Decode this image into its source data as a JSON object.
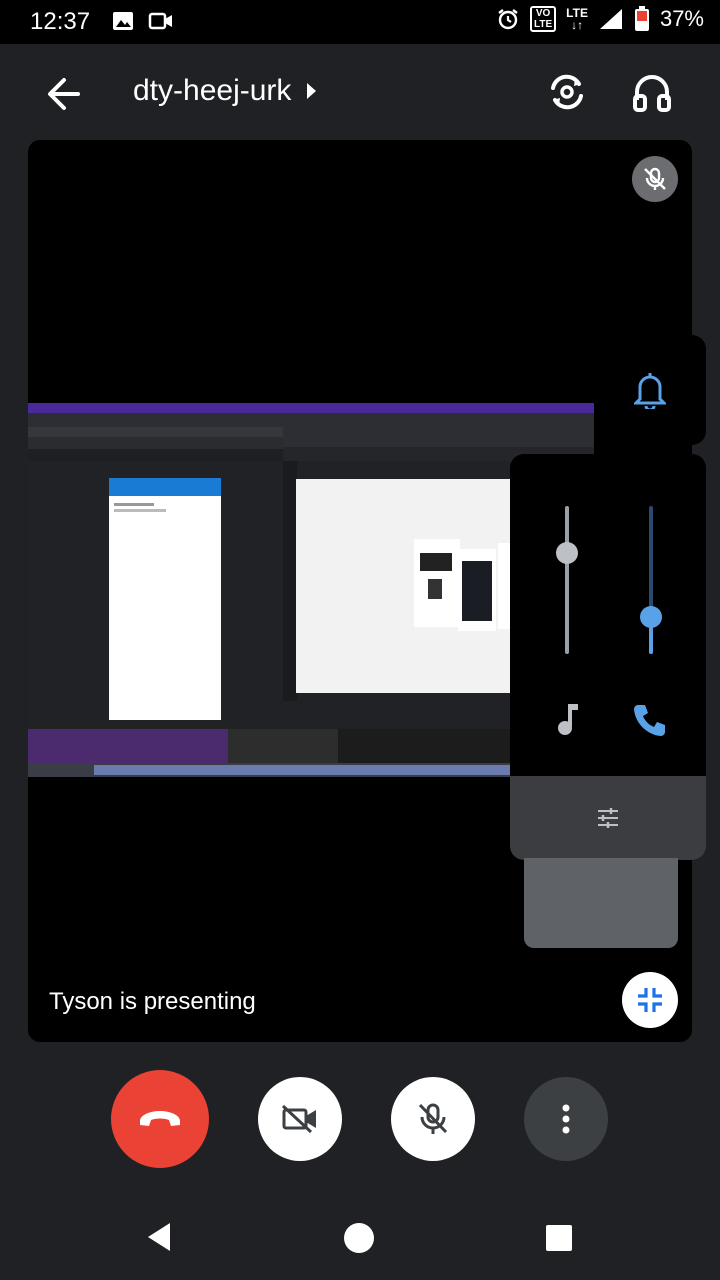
{
  "status_bar": {
    "time": "12:37",
    "network": "LTE",
    "volte": "VO\nLTE",
    "battery": "37%",
    "icons": [
      "image-icon",
      "video-icon",
      "alarm-icon",
      "signal-icon",
      "battery-icon"
    ]
  },
  "header": {
    "meeting_code": "dty-heej-urk",
    "back_icon": "arrow-back-icon",
    "switch_camera_icon": "switch-camera-icon",
    "audio_output_icon": "headphones-icon"
  },
  "tile": {
    "presenting_text": "Tyson is presenting",
    "mute_icon": "mic-off-icon",
    "minimize_icon": "fullscreen-exit-icon"
  },
  "volume_panel": {
    "media_volume": 0.68,
    "call_volume": 0.25,
    "media_icon": "music-note-icon",
    "call_icon": "phone-icon",
    "ringer_icon": "bell-icon",
    "settings_icon": "tune-icon",
    "accent_color": "#5aa2e8"
  },
  "controls": {
    "end_call_color": "#ea4335",
    "buttons": [
      "end-call-icon",
      "camera-off-icon",
      "mic-off-icon",
      "more-vert-icon"
    ]
  }
}
